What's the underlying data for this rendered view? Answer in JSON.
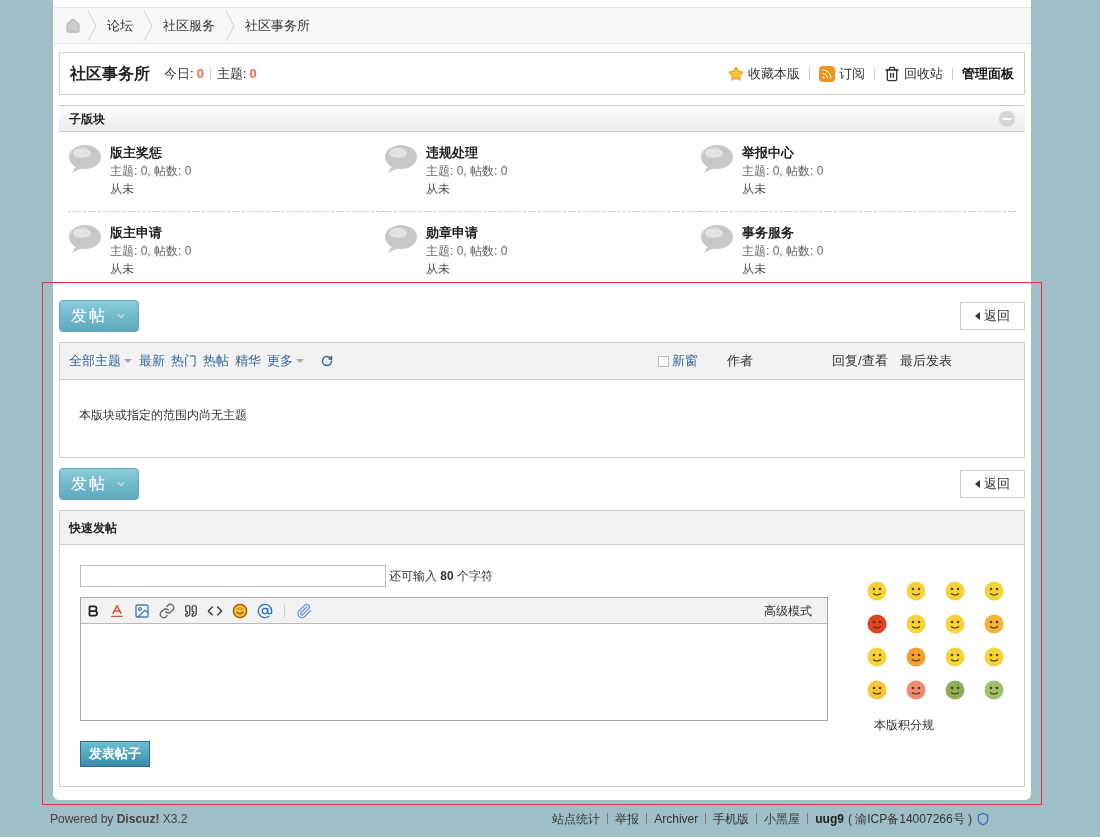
{
  "breadcrumb": [
    "论坛",
    "社区服务",
    "社区事务所"
  ],
  "forum": {
    "title": "社区事务所",
    "stats": [
      {
        "label": "今日:",
        "value": "0"
      },
      {
        "label": "主题:",
        "value": "0"
      }
    ],
    "actions": [
      {
        "kind": "star",
        "label": "收藏本版"
      },
      {
        "kind": "rss",
        "label": "订阅"
      },
      {
        "kind": "trash",
        "label": "回收站"
      },
      {
        "kind": "plain",
        "label": "管理面板"
      }
    ]
  },
  "subforums": {
    "title": "子版块",
    "items": [
      {
        "name": "版主奖惩",
        "stats": "主题: 0, 帖数: 0",
        "last": "从未"
      },
      {
        "name": "违规处理",
        "stats": "主题: 0, 帖数: 0",
        "last": "从未"
      },
      {
        "name": "举报中心",
        "stats": "主题: 0, 帖数: 0",
        "last": "从未"
      },
      {
        "name": "版主申请",
        "stats": "主题: 0, 帖数: 0",
        "last": "从未"
      },
      {
        "name": "勋章申请",
        "stats": "主题: 0, 帖数: 0",
        "last": "从未"
      },
      {
        "name": "事务服务",
        "stats": "主题: 0, 帖数: 0",
        "last": "从未"
      }
    ]
  },
  "post_button": "发帖",
  "back_button": "返回",
  "threads": {
    "filters": [
      {
        "label": "全部主题",
        "dropdown": true
      },
      {
        "label": "最新",
        "dropdown": false
      },
      {
        "label": "热门",
        "dropdown": false
      },
      {
        "label": "热帖",
        "dropdown": false
      },
      {
        "label": "精华",
        "dropdown": false
      },
      {
        "label": "更多",
        "dropdown": true
      }
    ],
    "new_window": {
      "label": "新窗",
      "checked": false
    },
    "columns": [
      "作者",
      "回复/查看",
      "最后发表"
    ],
    "empty": "本版块或指定的范围内尚无主题"
  },
  "post_button_2": "发帖",
  "back_button_2": "返回",
  "quick_post": {
    "title": "快速发帖",
    "counter": "还可输入 **80** 个字符",
    "editor_mode": "高级模式",
    "submit": "发表帖子",
    "rules_link": "本版积分规"
  },
  "footer": {
    "powered": "Powered by **Discuz!** X3.2",
    "links": [
      "站点统计",
      "举报",
      "Archiver",
      "手机版",
      "小黑屋"
    ],
    "user": "uug9",
    "icp": "( 渝ICP备14007266号 )"
  }
}
